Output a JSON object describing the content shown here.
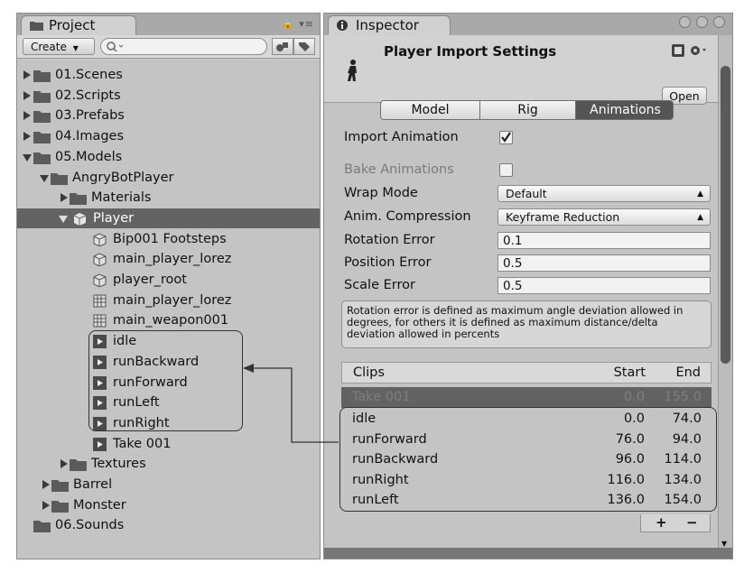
{
  "project_panel": {
    "tab_label": "Project",
    "create_label": "Create",
    "tree": [
      {
        "label": "01.Scenes"
      },
      {
        "label": "02.Scripts"
      },
      {
        "label": "03.Prefabs"
      },
      {
        "label": "04.Images"
      },
      {
        "label": "05.Models"
      },
      {
        "label": "AngryBotPlayer"
      },
      {
        "label": "Materials"
      },
      {
        "label": "Player"
      },
      {
        "label": "Bip001 Footsteps"
      },
      {
        "label": "main_player_lorez"
      },
      {
        "label": "player_root"
      },
      {
        "label": "main_player_lorez"
      },
      {
        "label": "main_weapon001"
      },
      {
        "label": "idle"
      },
      {
        "label": "runBackward"
      },
      {
        "label": "runForward"
      },
      {
        "label": "runLeft"
      },
      {
        "label": "runRight"
      },
      {
        "label": "Take 001"
      },
      {
        "label": "Textures"
      },
      {
        "label": "Barrel"
      },
      {
        "label": "Monster"
      },
      {
        "label": "06.Sounds"
      }
    ]
  },
  "inspector": {
    "tab_label": "Inspector",
    "header_title": "Player Import Settings",
    "open_label": "Open",
    "tabs": [
      "Model",
      "Rig",
      "Animations"
    ],
    "fields": {
      "import_animation": "Import Animation",
      "bake_animations": "Bake Animations",
      "wrap_mode_label": "Wrap Mode",
      "wrap_mode_value": "Default",
      "compression_label": "Anim. Compression",
      "compression_value": "Keyframe Reduction",
      "rotation_error_label": "Rotation Error",
      "rotation_error_value": "0.1",
      "position_error_label": "Position Error",
      "position_error_value": "0.5",
      "scale_error_label": "Scale Error",
      "scale_error_value": "0.5"
    },
    "help_text": "Rotation error is defined as maximum angle deviation allowed in degrees, for others it is defined as maximum distance/delta deviation allowed in percents",
    "clips": {
      "col_name": "Clips",
      "col_start": "Start",
      "col_end": "End",
      "rows": [
        {
          "name": "Take 001",
          "start": "0.0",
          "end": "155.0"
        },
        {
          "name": "idle",
          "start": "0.0",
          "end": "74.0"
        },
        {
          "name": "runForward",
          "start": "76.0",
          "end": "94.0"
        },
        {
          "name": "runBackward",
          "start": "96.0",
          "end": "114.0"
        },
        {
          "name": "runRight",
          "start": "116.0",
          "end": "134.0"
        },
        {
          "name": "runLeft",
          "start": "136.0",
          "end": "154.0"
        }
      ],
      "add_label": "+",
      "remove_label": "−"
    }
  },
  "colors": {
    "panel_bg": "#c4c4c4",
    "selection": "#636363",
    "active_tab": "#555555"
  }
}
